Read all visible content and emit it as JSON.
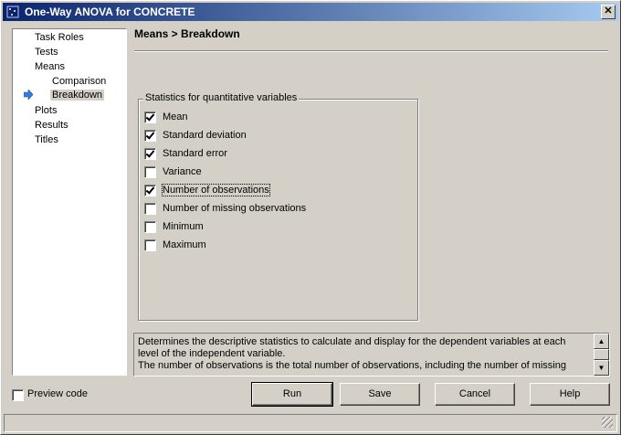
{
  "window": {
    "title": "One-Way ANOVA for CONCRETE",
    "close_label": "✕"
  },
  "nav": {
    "items": [
      {
        "label": "Task Roles",
        "level": 0,
        "selected": false
      },
      {
        "label": "Tests",
        "level": 0,
        "selected": false
      },
      {
        "label": "Means",
        "level": 0,
        "selected": false
      },
      {
        "label": "Comparison",
        "level": 1,
        "selected": false
      },
      {
        "label": "Breakdown",
        "level": 1,
        "selected": true
      },
      {
        "label": "Plots",
        "level": 0,
        "selected": false
      },
      {
        "label": "Results",
        "level": 0,
        "selected": false
      },
      {
        "label": "Titles",
        "level": 0,
        "selected": false
      }
    ]
  },
  "breadcrumb": "Means > Breakdown",
  "stats_group": {
    "title": "Statistics for quantitative variables",
    "options": [
      {
        "label": "Mean",
        "checked": true
      },
      {
        "label": "Standard deviation",
        "checked": true
      },
      {
        "label": "Standard error",
        "checked": true
      },
      {
        "label": "Variance",
        "checked": false
      },
      {
        "label": "Number of observations",
        "checked": true
      },
      {
        "label": "Number of missing observations",
        "checked": false
      },
      {
        "label": "Minimum",
        "checked": false
      },
      {
        "label": "Maximum",
        "checked": false
      }
    ]
  },
  "description": "Determines the descriptive statistics to calculate and display for the dependent variables at each level of the independent variable.\nThe number of observations is the total number of observations, including the number of missing",
  "preview": {
    "label": "Preview code",
    "checked": false
  },
  "buttons": {
    "run": "Run",
    "save": "Save",
    "cancel": "Cancel",
    "help": "Help"
  }
}
